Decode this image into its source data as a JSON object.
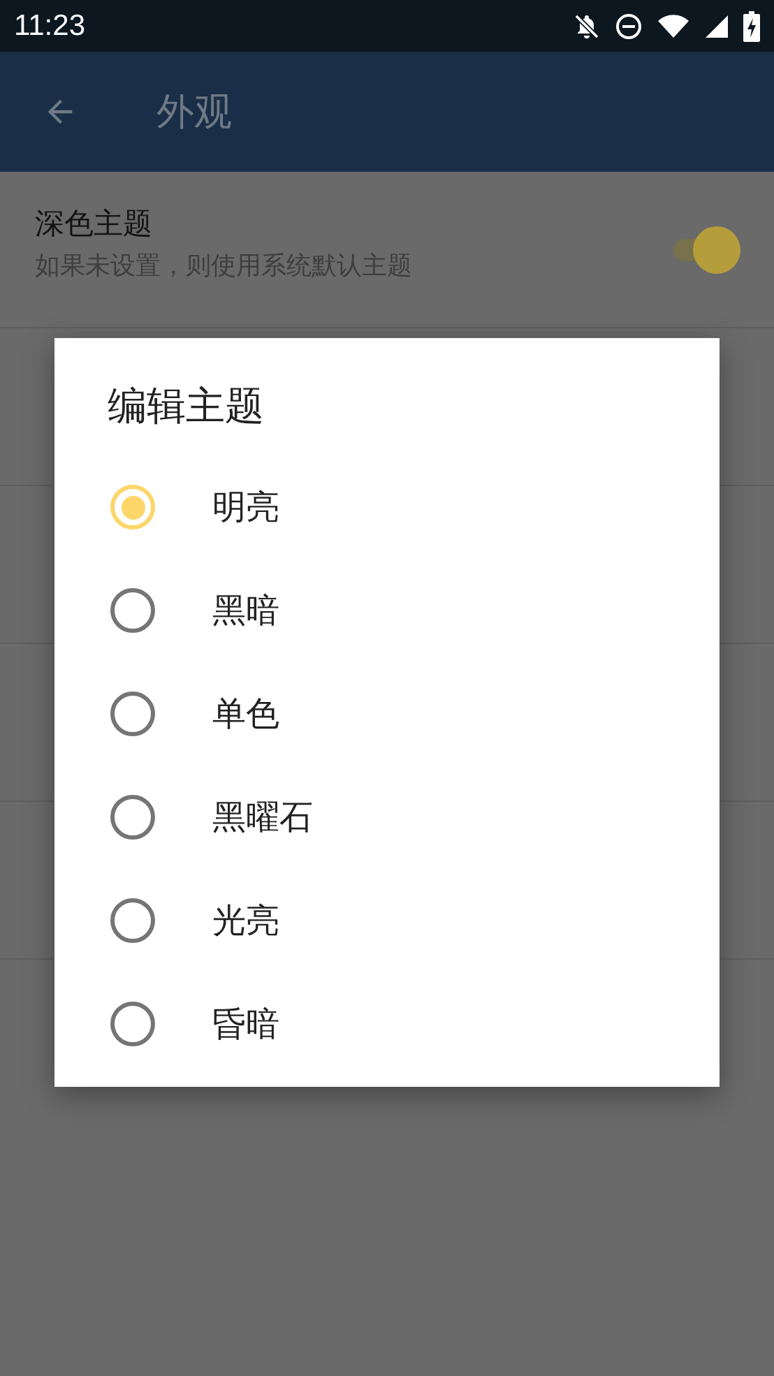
{
  "status_bar": {
    "time": "11:23"
  },
  "app_bar": {
    "title": "外观"
  },
  "settings": [
    {
      "title": "深色主题",
      "subtitle": "如果未设置，则使用系统默认主题",
      "on": true
    }
  ],
  "dialog": {
    "title": "编辑主题",
    "options": [
      {
        "label": "明亮",
        "selected": true
      },
      {
        "label": "黑暗",
        "selected": false
      },
      {
        "label": "单色",
        "selected": false
      },
      {
        "label": "黑曜石",
        "selected": false
      },
      {
        "label": "光亮",
        "selected": false
      },
      {
        "label": "昏暗",
        "selected": false
      }
    ]
  }
}
